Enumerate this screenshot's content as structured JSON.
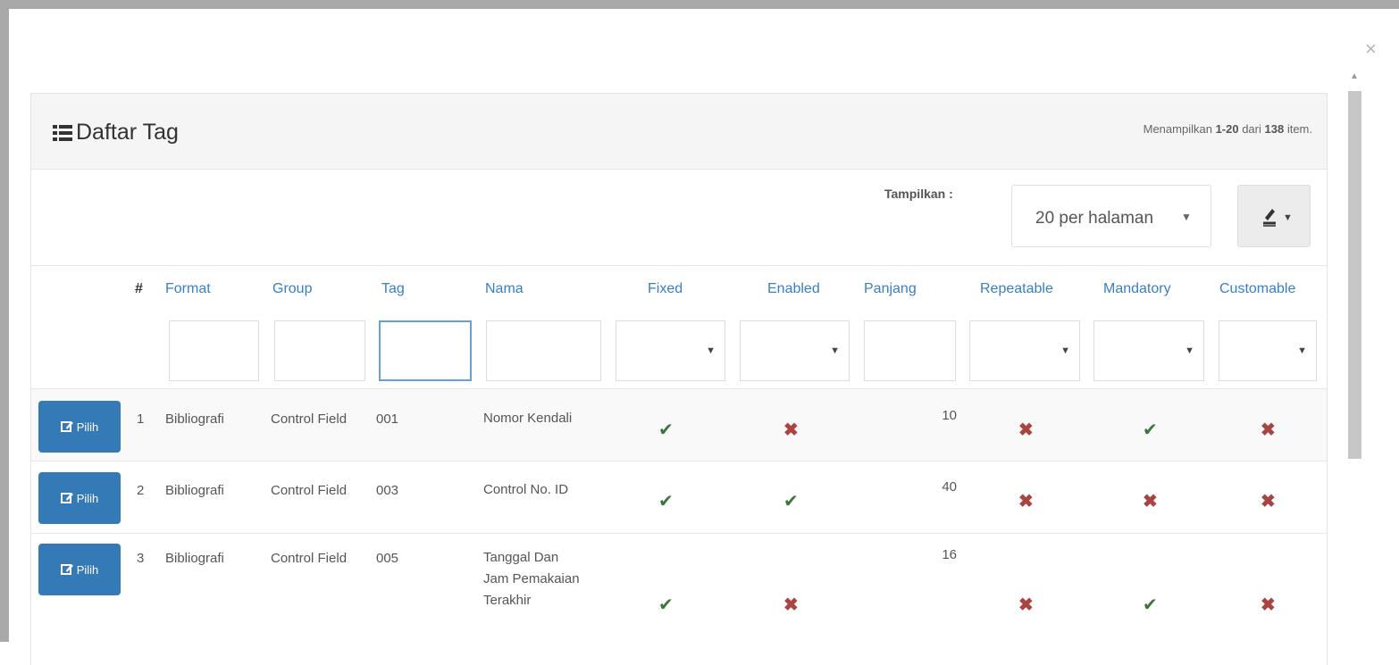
{
  "dialog": {
    "close_label": "×"
  },
  "panel": {
    "title": "Daftar Tag",
    "summary_prefix": "Menampilkan ",
    "summary_range": "1-20",
    "summary_mid": " dari ",
    "summary_total": "138",
    "summary_suffix": " item."
  },
  "toolbar": {
    "show_label": "Tampilkan :",
    "per_page_value": "20 per halaman"
  },
  "table": {
    "headers": [
      "#",
      "Format",
      "Group",
      "Tag",
      "Nama",
      "Fixed",
      "Enabled",
      "Panjang",
      "Repeatable",
      "Mandatory",
      "Customable"
    ],
    "action_label": "Pilih",
    "rows": [
      {
        "no": "1",
        "format": "Bibliografi",
        "group": "Control Field",
        "tag": "001",
        "nama": "Nomor Kendali",
        "fixed": true,
        "enabled": false,
        "panjang": "10",
        "repeatable": false,
        "mandatory": true,
        "customable": false
      },
      {
        "no": "2",
        "format": "Bibliografi",
        "group": "Control Field",
        "tag": "003",
        "nama": "Control No. ID",
        "fixed": true,
        "enabled": true,
        "panjang": "40",
        "repeatable": false,
        "mandatory": false,
        "customable": false
      },
      {
        "no": "3",
        "format": "Bibliografi",
        "group": "Control Field",
        "tag": "005",
        "nama": "Tanggal Dan Jam Pemakaian Terakhir",
        "fixed": true,
        "enabled": false,
        "panjang": "16",
        "repeatable": false,
        "mandatory": true,
        "customable": false
      }
    ]
  },
  "colors": {
    "primary": "#337ab7",
    "link": "#3a7fc1",
    "check": "#3c763d",
    "cross": "#a94442"
  },
  "icons": {
    "title": "list-icon",
    "button": "edit-icon",
    "export": "export-icon",
    "check": "check-icon",
    "cross": "cross-icon"
  }
}
